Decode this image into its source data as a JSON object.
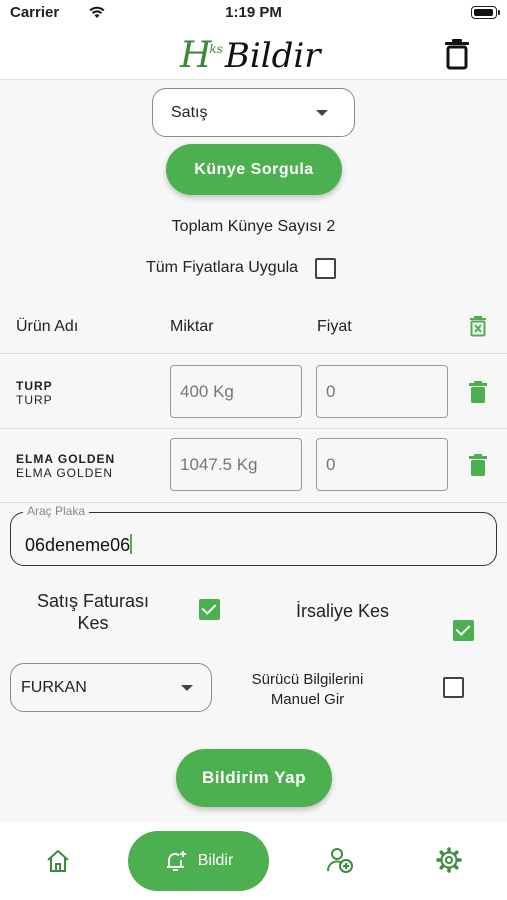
{
  "status_bar": {
    "carrier": "Carrier",
    "time": "1:19 PM"
  },
  "header": {
    "logo_h": "H",
    "logo_ks": "ks",
    "logo_word": "Bildir"
  },
  "transaction_type": {
    "selected": "Satış"
  },
  "kunye_button": {
    "label": "Künye Sorgula"
  },
  "summary": {
    "total_text": "Toplam Künye Sayısı 2"
  },
  "apply_all": {
    "label": "Tüm Fiyatlara Uygula",
    "checked": false
  },
  "table": {
    "headers": {
      "product": "Ürün Adı",
      "quantity": "Miktar",
      "price": "Fiyat"
    },
    "rows": [
      {
        "name": "TURP",
        "subname": "TURP",
        "quantity": "400 Kg",
        "price": "0"
      },
      {
        "name": "ELMA GOLDEN",
        "subname": "ELMA GOLDEN",
        "quantity": "1047.5 Kg",
        "price": "0"
      }
    ]
  },
  "plate": {
    "label": "Araç Plaka",
    "value": "06deneme06"
  },
  "options": {
    "sales_invoice": {
      "label_line1": "Satış Faturası",
      "label_line2": "Kes",
      "checked": true
    },
    "waybill": {
      "label": "İrsaliye Kes",
      "checked": true
    }
  },
  "driver": {
    "selected": "FURKAN",
    "manual_label_line1": "Sürücü Bilgilerini",
    "manual_label_line2": "Manuel Gir",
    "manual_checked": false
  },
  "submit_button": {
    "label": "Bildirim Yap"
  },
  "bottom_nav": {
    "items": [
      {
        "icon": "home-icon"
      },
      {
        "icon": "bell-plus-icon",
        "label": "Bildir"
      },
      {
        "icon": "user-plus-icon"
      },
      {
        "icon": "gear-icon"
      }
    ]
  },
  "colors": {
    "accent": "#4caf50",
    "background": "#f7f7f7"
  }
}
